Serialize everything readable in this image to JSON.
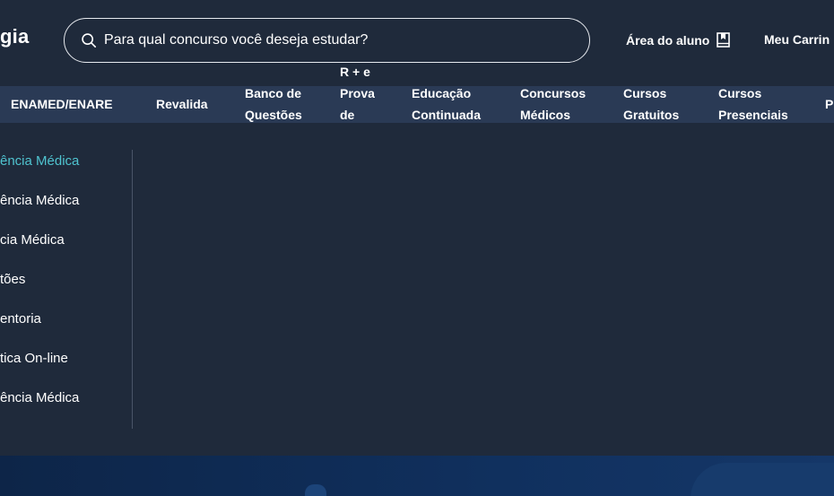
{
  "header": {
    "logo_text": "gia",
    "search": {
      "placeholder": "Para qual concurso você deseja estudar?"
    },
    "area_aluno_label": "Área do aluno",
    "carrinho_label": "Meu Carrin"
  },
  "nav": {
    "items": [
      {
        "line1": "ENAMED/ENARE",
        "line2": ""
      },
      {
        "line1": "Revalida",
        "line2": ""
      },
      {
        "line1": "Banco de",
        "line2": "Questões"
      },
      {
        "line0": "R + e",
        "line1": "Prova",
        "line2": "de"
      },
      {
        "line1": "Educação",
        "line2": "Continuada"
      },
      {
        "line1": "Concursos",
        "line2": "Médicos"
      },
      {
        "line1": "Cursos",
        "line2": "Gratuitos"
      },
      {
        "line1": "Cursos",
        "line2": "Presenciais"
      },
      {
        "line1": "P",
        "line2": ""
      }
    ]
  },
  "dropdown": {
    "items": [
      "ência Médica",
      "ência Médica",
      "cia Médica",
      "tões",
      "entoria",
      "tica On-line",
      "ência Médica"
    ]
  },
  "colors": {
    "background": "#1f2a3b",
    "navbar": "#2a3a55",
    "accent": "#4fc3cf",
    "bottom_band": "#0f2a52"
  }
}
